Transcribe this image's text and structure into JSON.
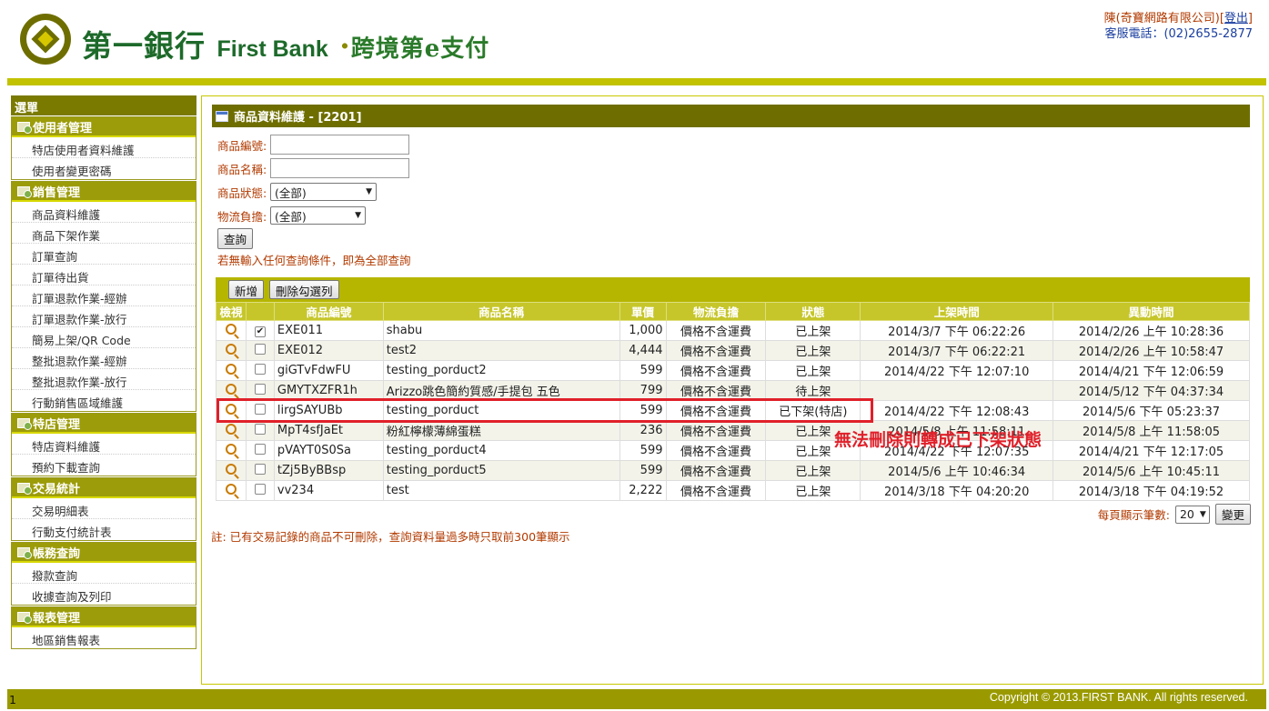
{
  "header": {
    "brand_cn": "第一銀行",
    "brand_en": "First Bank",
    "brand_sep": "·",
    "brand_sub": "跨境第e支付",
    "company": "陳(奇寶網路有限公司)",
    "logout": "登出",
    "phone": "客服電話：(02)2655-2877"
  },
  "sidebar": {
    "title": "選單",
    "groups": [
      {
        "title": "使用者管理",
        "items": [
          "特店使用者資料維護",
          "使用者變更密碼"
        ]
      },
      {
        "title": "銷售管理",
        "items": [
          "商品資料維護",
          "商品下架作業",
          "訂單查詢",
          "訂單待出貨",
          "訂單退款作業-經辦",
          "訂單退款作業-放行",
          "簡易上架/QR Code",
          "整批退款作業-經辦",
          "整批退款作業-放行",
          "行動銷售區域維護"
        ]
      },
      {
        "title": "特店管理",
        "items": [
          "特店資料維護",
          "預約下載查詢"
        ]
      },
      {
        "title": "交易統計",
        "items": [
          "交易明細表",
          "行動支付統計表"
        ]
      },
      {
        "title": "帳務查詢",
        "items": [
          "撥款查詢",
          "收據查詢及列印"
        ]
      },
      {
        "title": "報表管理",
        "items": [
          "地區銷售報表"
        ]
      }
    ]
  },
  "panel": {
    "title": "商品資料維護 - [2201]",
    "form": {
      "product_id_label": "商品編號:",
      "product_name_label": "商品名稱:",
      "status_label": "商品狀態:",
      "status_value": "(全部)",
      "shipping_label": "物流負擔:",
      "shipping_value": "(全部)",
      "query_button": "查詢",
      "hint": "若無輸入任何查詢條件，即為全部查詢"
    },
    "toolbar": {
      "add": "新增",
      "delete_selected": "刪除勾選列"
    },
    "columns": [
      "檢視",
      "",
      "商品編號",
      "商品名稱",
      "單價",
      "物流負擔",
      "狀態",
      "上架時間",
      "異動時間"
    ],
    "rows": [
      {
        "id": "EXE011",
        "name": "shabu",
        "price": "1,000",
        "shipping": "價格不含運費",
        "status": "已上架",
        "listed": "2014/3/7 下午 06:22:26",
        "modified": "2014/2/26 上午 10:28:36",
        "checked": true
      },
      {
        "id": "EXE012",
        "name": "test2",
        "price": "4,444",
        "shipping": "價格不含運費",
        "status": "已上架",
        "listed": "2014/3/7 下午 06:22:21",
        "modified": "2014/2/26 上午 10:58:47",
        "checked": false
      },
      {
        "id": "giGTvFdwFU",
        "name": "testing_porduct2",
        "price": "599",
        "shipping": "價格不含運費",
        "status": "已上架",
        "listed": "2014/4/22 下午 12:07:10",
        "modified": "2014/4/21 下午 12:06:59",
        "checked": false
      },
      {
        "id": "GMYTXZFR1h",
        "name": "Arizzo跳色簡約質感/手提包 五色",
        "price": "799",
        "shipping": "價格不含運費",
        "status": "待上架",
        "listed": "",
        "modified": "2014/5/12 下午 04:37:34",
        "checked": false
      },
      {
        "id": "lirgSAYUBb",
        "name": "testing_porduct",
        "price": "599",
        "shipping": "價格不含運費",
        "status": "已下架(特店)",
        "listed": "2014/4/22 下午 12:08:43",
        "modified": "2014/5/6 下午 05:23:37",
        "checked": false
      },
      {
        "id": "MpT4sfJaEt",
        "name": "粉紅檸檬薄綿蛋糕",
        "price": "236",
        "shipping": "價格不含運費",
        "status": "已上架",
        "listed": "2014/5/8 上午 11:58:11",
        "modified": "2014/5/8 上午 11:58:05",
        "checked": false
      },
      {
        "id": "pVAYT0S0Sa",
        "name": "testing_porduct4",
        "price": "599",
        "shipping": "價格不含運費",
        "status": "已上架",
        "listed": "2014/4/22 下午 12:07:35",
        "modified": "2014/4/21 下午 12:17:05",
        "checked": false
      },
      {
        "id": "tZj5ByBBsp",
        "name": "testing_porduct5",
        "price": "599",
        "shipping": "價格不含運費",
        "status": "已上架",
        "listed": "2014/5/6 上午 10:46:34",
        "modified": "2014/5/6 上午 10:45:11",
        "checked": false
      },
      {
        "id": "vv234",
        "name": "test",
        "price": "2,222",
        "shipping": "價格不含運費",
        "status": "已上架",
        "listed": "2014/3/18 下午 04:20:20",
        "modified": "2014/3/18 下午 04:19:52",
        "checked": false
      }
    ],
    "pager": {
      "label": "每頁顯示筆數:",
      "value": "20",
      "change": "變更"
    },
    "note": "註: 已有交易記錄的商品不可刪除，查詢資料量過多時只取前300筆顯示"
  },
  "annotation": "無法刪除則轉成已下架狀態",
  "footer": {
    "page_number": "1",
    "copyright": "Copyright © 2013.FIRST BANK. All rights reserved."
  }
}
